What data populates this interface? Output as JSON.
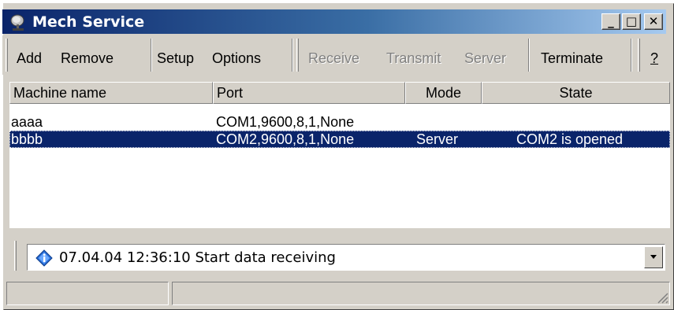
{
  "window": {
    "title": "Mech Service",
    "icon": "satellite-dish-icon"
  },
  "titlebar_buttons": {
    "minimize": "_",
    "maximize": "□",
    "close": "✕"
  },
  "toolbar": {
    "add": "Add",
    "remove": "Remove",
    "setup": "Setup",
    "options": "Options",
    "receive": "Receive",
    "transmit": "Transmit",
    "server": "Server",
    "terminate": "Terminate",
    "help": "?"
  },
  "list": {
    "columns": [
      "Machine name",
      "Port",
      "Mode",
      "State"
    ],
    "rows": [
      {
        "machine": "aaaa",
        "port": "COM1,9600,8,1,None",
        "mode": "",
        "state": ""
      },
      {
        "machine": "bbbb",
        "port": "COM2,9600,8,1,None",
        "mode": "Server",
        "state": "COM2 is opened",
        "selected": true
      }
    ]
  },
  "log": {
    "message": "07.04.04 12:36:10 Start data receiving",
    "icon": "info-diamond-icon"
  },
  "colors": {
    "title_start": "#0a246a",
    "title_end": "#a6caf0",
    "selection": "#0a246a",
    "face": "#d4d0c8"
  }
}
